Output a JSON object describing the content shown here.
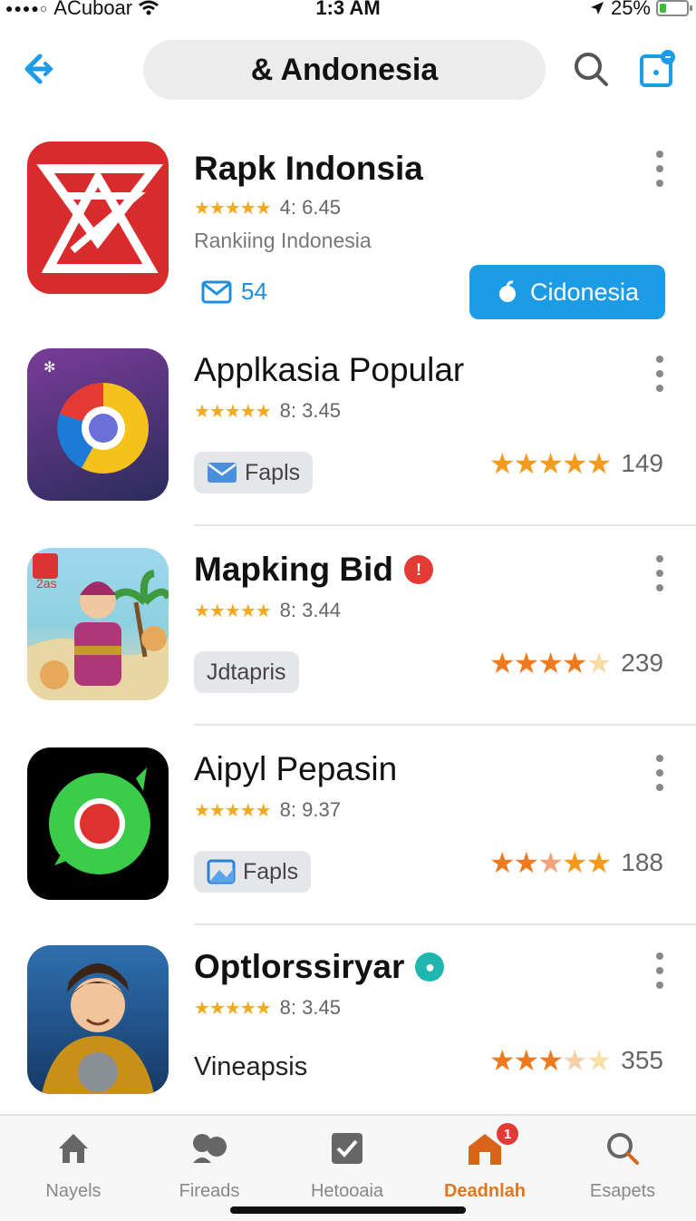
{
  "status_bar": {
    "carrier": "ACuboar",
    "time": "1:3 AM",
    "battery_text": "25%",
    "battery_level": 0.25,
    "battery_color": "#3dbb3d"
  },
  "header": {
    "title": "& Andonesia",
    "back_icon": "back-arrow-icon",
    "search_icon": "search-icon",
    "share_icon": "share-icon"
  },
  "accent_color": "#1c9be6",
  "apps": [
    {
      "title": "Rapk Indonsia",
      "meta": "4: 6.45",
      "subtitle": "Rankiing Indonesia",
      "message_count": "54",
      "button_label": "Cidonesia"
    },
    {
      "title": "Applkasia Popular",
      "meta": "8: 3.45",
      "chip": "Fapls",
      "rating_count": "149",
      "rating": 5
    },
    {
      "title": "Mapking Bid",
      "meta": "8: 3.44",
      "chip": "Jdtapris",
      "rating_count": "239",
      "rating": 4
    },
    {
      "title": "Aipyl Pepasin",
      "meta": "8: 9.37",
      "chip": "Fapls",
      "rating_count": "188",
      "rating": 5
    },
    {
      "title": "Optlorssiryar",
      "meta": "8: 3.45",
      "subtitle": "Vineapsis",
      "rating_count": "355",
      "rating": 3
    }
  ],
  "tabs": [
    {
      "label": "Nayels",
      "icon": "home-icon"
    },
    {
      "label": "Fireads",
      "icon": "friends-icon"
    },
    {
      "label": "Hetooaia",
      "icon": "checkbox-icon"
    },
    {
      "label": "Deadnlah",
      "icon": "house-icon",
      "badge": "1",
      "active": true
    },
    {
      "label": "Esapets",
      "icon": "search-icon"
    }
  ]
}
